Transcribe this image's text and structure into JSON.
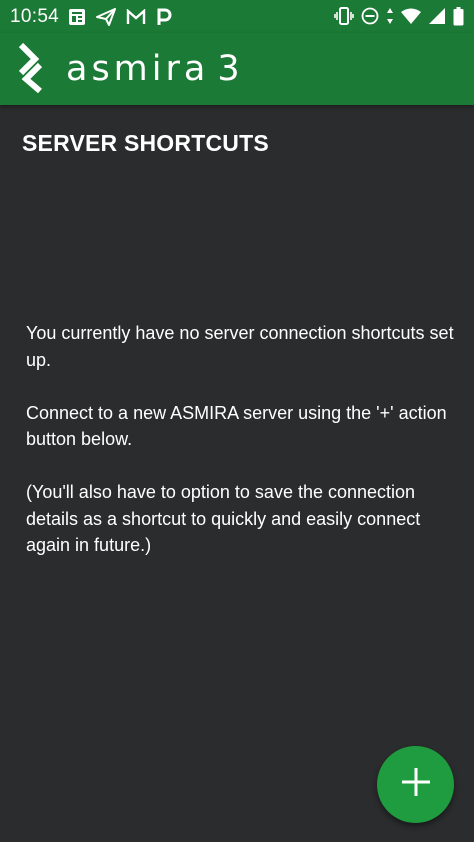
{
  "status_bar": {
    "time": "10:54",
    "left_icons": [
      "news-icon",
      "send-icon",
      "gmail-icon",
      "parking-icon"
    ],
    "right_icons": [
      "vibrate-icon",
      "do-not-disturb-icon",
      "data-arrows-icon",
      "wifi-icon",
      "signal-icon",
      "battery-icon"
    ]
  },
  "app_bar": {
    "logo_icon": "asmira-logo-icon",
    "title": "asmira",
    "version": "3"
  },
  "content": {
    "heading": "SERVER SHORTCUTS",
    "paragraphs": [
      "You currently have no server connection shortcuts set up.",
      "Connect to a new ASMIRA server using the '+' action button below.",
      "(You'll also have to option to save the connection details as a shortcut to quickly and easily connect again in future.)"
    ]
  },
  "fab": {
    "icon": "plus-icon",
    "label": "+"
  },
  "colors": {
    "brand_green": "#1b7a35",
    "fab_green": "#1e9c3f",
    "background": "#2b2c2e",
    "text": "#ffffff"
  }
}
